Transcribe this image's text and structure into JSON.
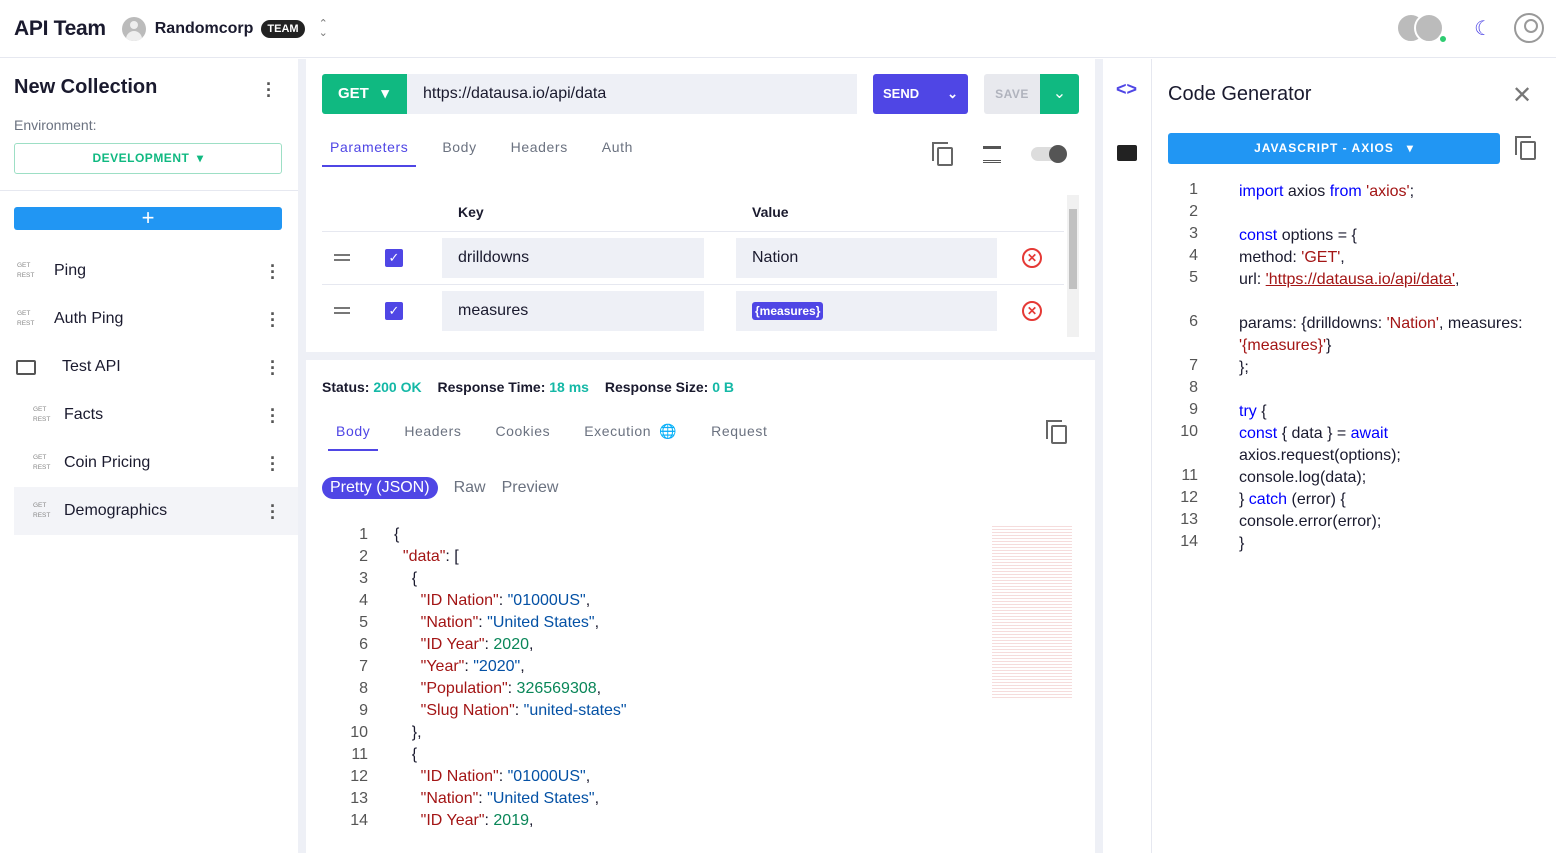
{
  "header": {
    "team": "API Team",
    "org": "Randomcorp",
    "badge": "TEAM",
    "colors": {
      "accent": "#4f46e5",
      "green": "#10b981",
      "blue": "#2196f3"
    }
  },
  "sidebar": {
    "title": "New Collection",
    "env_label": "Environment:",
    "env_value": "DEVELOPMENT",
    "add_label": "+",
    "items": [
      {
        "method": "GET",
        "type": "REST",
        "name": "Ping"
      },
      {
        "method": "GET",
        "type": "REST",
        "name": "Auth Ping"
      },
      {
        "folder": true,
        "name": "Test API"
      },
      {
        "method": "GET",
        "type": "REST",
        "name": "Facts"
      },
      {
        "method": "GET",
        "type": "REST",
        "name": "Coin Pricing"
      },
      {
        "method": "GET",
        "type": "REST",
        "name": "Demographics",
        "selected": true
      }
    ]
  },
  "request": {
    "method": "GET",
    "url": "https://datausa.io/api/data",
    "send": "SEND",
    "save": "SAVE",
    "tabs": [
      "Parameters",
      "Body",
      "Headers",
      "Auth"
    ],
    "params_headers": {
      "key": "Key",
      "value": "Value"
    },
    "params": [
      {
        "key": "drilldowns",
        "value": "Nation",
        "checked": true
      },
      {
        "key": "measures",
        "value": "{measures}",
        "checked": true
      }
    ]
  },
  "response": {
    "status_label": "Status:",
    "status": "200 OK",
    "time_label": "Response Time:",
    "time": "18 ms",
    "size_label": "Response Size:",
    "size": "0 B",
    "tabs": [
      "Body",
      "Headers",
      "Cookies",
      "Execution",
      "Request"
    ],
    "views": [
      "Pretty (JSON)",
      "Raw",
      "Preview"
    ],
    "lines": [
      [
        [
          "{",
          ""
        ]
      ],
      [
        [
          "  ",
          ""
        ],
        [
          "\"data\"",
          "k"
        ],
        [
          ": [",
          ""
        ]
      ],
      [
        [
          "    {",
          ""
        ]
      ],
      [
        [
          "      ",
          ""
        ],
        [
          "\"ID Nation\"",
          "k"
        ],
        [
          ": ",
          ""
        ],
        [
          "\"01000US\"",
          "s"
        ],
        [
          ",",
          ""
        ]
      ],
      [
        [
          "      ",
          ""
        ],
        [
          "\"Nation\"",
          "k"
        ],
        [
          ": ",
          ""
        ],
        [
          "\"United States\"",
          "s"
        ],
        [
          ",",
          ""
        ]
      ],
      [
        [
          "      ",
          ""
        ],
        [
          "\"ID Year\"",
          "k"
        ],
        [
          ": ",
          ""
        ],
        [
          "2020",
          "n"
        ],
        [
          ",",
          ""
        ]
      ],
      [
        [
          "      ",
          ""
        ],
        [
          "\"Year\"",
          "k"
        ],
        [
          ": ",
          ""
        ],
        [
          "\"2020\"",
          "s"
        ],
        [
          ",",
          ""
        ]
      ],
      [
        [
          "      ",
          ""
        ],
        [
          "\"Population\"",
          "k"
        ],
        [
          ": ",
          ""
        ],
        [
          "326569308",
          "n"
        ],
        [
          ",",
          ""
        ]
      ],
      [
        [
          "      ",
          ""
        ],
        [
          "\"Slug Nation\"",
          "k"
        ],
        [
          ": ",
          ""
        ],
        [
          "\"united-states\"",
          "s"
        ]
      ],
      [
        [
          "    },",
          ""
        ]
      ],
      [
        [
          "    {",
          ""
        ]
      ],
      [
        [
          "      ",
          ""
        ],
        [
          "\"ID Nation\"",
          "k"
        ],
        [
          ": ",
          ""
        ],
        [
          "\"01000US\"",
          "s"
        ],
        [
          ",",
          ""
        ]
      ],
      [
        [
          "      ",
          ""
        ],
        [
          "\"Nation\"",
          "k"
        ],
        [
          ": ",
          ""
        ],
        [
          "\"United States\"",
          "s"
        ],
        [
          ",",
          ""
        ]
      ],
      [
        [
          "      ",
          ""
        ],
        [
          "\"ID Year\"",
          "k"
        ],
        [
          ": ",
          ""
        ],
        [
          "2019",
          "n"
        ],
        [
          ",",
          ""
        ]
      ]
    ]
  },
  "codegen": {
    "title": "Code Generator",
    "language": "JAVASCRIPT - AXIOS",
    "lines": [
      {
        "n": "1",
        "t": [
          [
            "import",
            "kw"
          ],
          [
            " axios ",
            ""
          ],
          [
            "from",
            "kw"
          ],
          [
            " 'axios'",
            "st"
          ],
          [
            ";",
            ""
          ]
        ]
      },
      {
        "n": "2",
        "t": []
      },
      {
        "n": "3",
        "t": [
          [
            "const",
            "kw"
          ],
          [
            " options = {",
            ""
          ]
        ]
      },
      {
        "n": "4",
        "t": [
          [
            "  method: ",
            ""
          ],
          [
            "'GET'",
            "st"
          ],
          [
            ",",
            ""
          ]
        ]
      },
      {
        "n": "5",
        "t": [
          [
            "  url: ",
            ""
          ],
          [
            "'https://datausa.io/api/data'",
            "st u"
          ],
          [
            ",",
            ""
          ]
        ]
      },
      {
        "n": "6",
        "t": [
          [
            "  params: {drilldowns: ",
            ""
          ],
          [
            "'Nation'",
            "st"
          ],
          [
            ", measures: ",
            ""
          ],
          [
            "'{measures}'",
            "st"
          ],
          [
            "}",
            ""
          ]
        ]
      },
      {
        "n": "7",
        "t": [
          [
            "};",
            ""
          ]
        ]
      },
      {
        "n": "8",
        "t": []
      },
      {
        "n": "9",
        "t": [
          [
            "try",
            "kw"
          ],
          [
            " {",
            ""
          ]
        ]
      },
      {
        "n": "10",
        "t": [
          [
            "    ",
            ""
          ],
          [
            "const",
            "kw"
          ],
          [
            " { data } = ",
            ""
          ],
          [
            "await",
            "kw"
          ],
          [
            " axios.request(options);",
            ""
          ]
        ]
      },
      {
        "n": "11",
        "t": [
          [
            "    console.log(data);",
            ""
          ]
        ]
      },
      {
        "n": "12",
        "t": [
          [
            "} ",
            ""
          ],
          [
            "catch",
            "kw"
          ],
          [
            " (error) {",
            ""
          ]
        ]
      },
      {
        "n": "13",
        "t": [
          [
            "    console.error(error);",
            ""
          ]
        ]
      },
      {
        "n": "14",
        "t": [
          [
            "}",
            ""
          ]
        ]
      }
    ]
  }
}
